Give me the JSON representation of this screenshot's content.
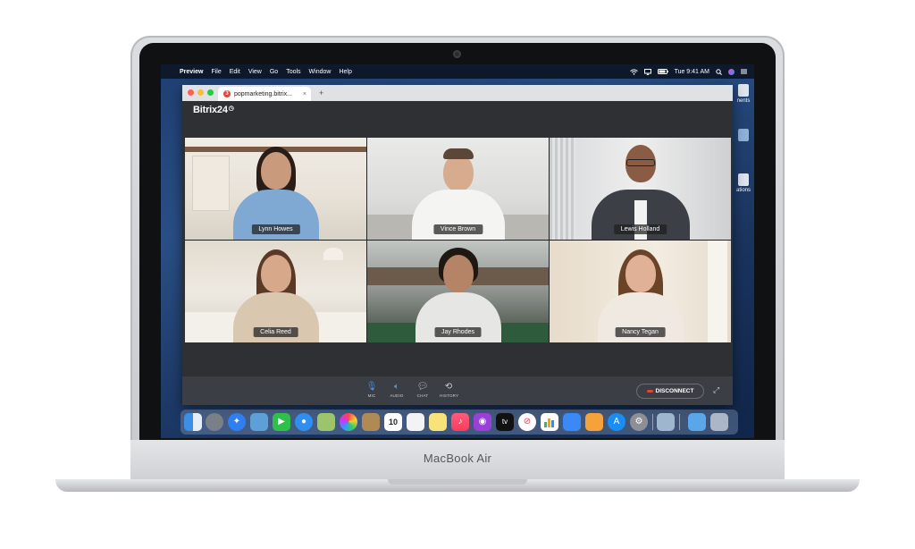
{
  "device": {
    "brand_label": "MacBook Air"
  },
  "menubar": {
    "apple_glyph": "",
    "app_name": "Preview",
    "items": [
      "File",
      "Edit",
      "View",
      "Go",
      "Tools",
      "Window",
      "Help"
    ],
    "clock": "Tue 9:41 AM"
  },
  "desktop_labels": [
    "nents",
    "ations"
  ],
  "browser": {
    "tab_title": "popmarketing.bitrix...",
    "tab_badge": "3",
    "close_glyph": "×",
    "new_tab_glyph": "+"
  },
  "app": {
    "logo_text": "Bitrix24"
  },
  "participants": [
    {
      "name": "Lynn Howes"
    },
    {
      "name": "Vince Brown"
    },
    {
      "name": "Lewis Holland"
    },
    {
      "name": "Celia Reed"
    },
    {
      "name": "Jay Rhodes"
    },
    {
      "name": "Nancy Tegan"
    }
  ],
  "controls": {
    "mic": "MIC",
    "audio": "AUDIO",
    "chat": "CHAT",
    "history": "HISTORY",
    "disconnect": "DISCONNECT",
    "expand_glyph": "⤢"
  },
  "dock": {
    "calendar_day": "10",
    "apple_tv": "tv"
  },
  "colors": {
    "disconnect_accent": "#e0443a",
    "app_background": "#2e3034"
  }
}
